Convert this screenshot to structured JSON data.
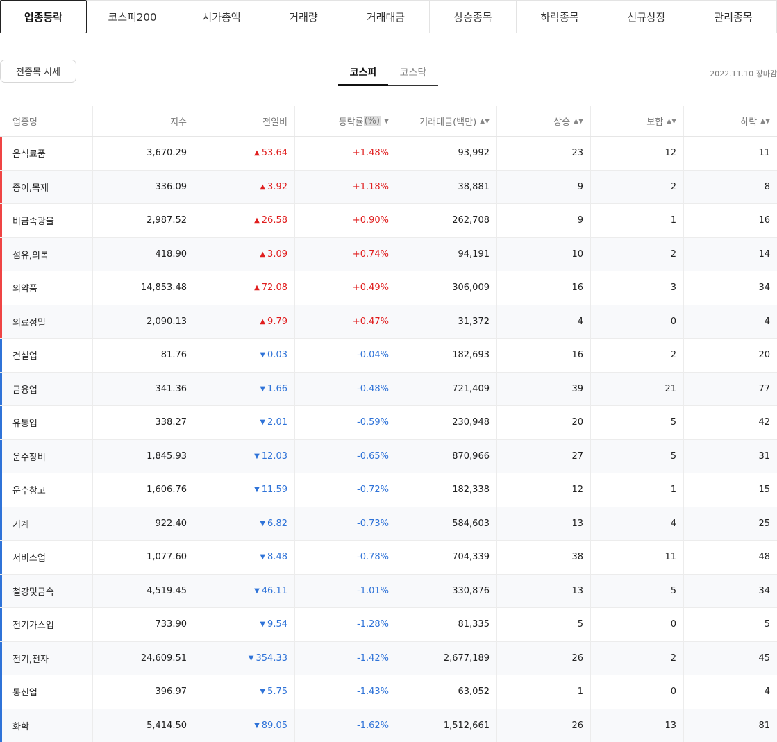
{
  "top_tabs": [
    "업종등락",
    "코스피200",
    "시가총액",
    "거래량",
    "거래대금",
    "상승종목",
    "하락종목",
    "신규상장",
    "관리종목"
  ],
  "all_button": "전종목 시세",
  "market_tabs": [
    "코스피",
    "코스닥"
  ],
  "date_text": "2022.11.10 장마감",
  "columns": {
    "name": "업종명",
    "index": "지수",
    "change": "전일비",
    "rate_pre": "등락률",
    "rate_pct": "(%)",
    "amount": "거래대금(백만)",
    "rise": "상승",
    "flat": "보합",
    "fall": "하락"
  },
  "icons": {
    "up": "▲",
    "down": "▼",
    "sort": "▲▼",
    "desc": "▼"
  },
  "colors": {
    "up": "#e01e1e",
    "down": "#2f73d8"
  },
  "rows": [
    {
      "name": "음식료품",
      "index": "3,670.29",
      "change": "53.64",
      "rate": "+1.48%",
      "amount": "93,992",
      "rise": "23",
      "flat": "12",
      "fall": "11",
      "dir": "up"
    },
    {
      "name": "종이,목재",
      "index": "336.09",
      "change": "3.92",
      "rate": "+1.18%",
      "amount": "38,881",
      "rise": "9",
      "flat": "2",
      "fall": "8",
      "dir": "up"
    },
    {
      "name": "비금속광물",
      "index": "2,987.52",
      "change": "26.58",
      "rate": "+0.90%",
      "amount": "262,708",
      "rise": "9",
      "flat": "1",
      "fall": "16",
      "dir": "up"
    },
    {
      "name": "섬유,의복",
      "index": "418.90",
      "change": "3.09",
      "rate": "+0.74%",
      "amount": "94,191",
      "rise": "10",
      "flat": "2",
      "fall": "14",
      "dir": "up"
    },
    {
      "name": "의약품",
      "index": "14,853.48",
      "change": "72.08",
      "rate": "+0.49%",
      "amount": "306,009",
      "rise": "16",
      "flat": "3",
      "fall": "34",
      "dir": "up"
    },
    {
      "name": "의료정밀",
      "index": "2,090.13",
      "change": "9.79",
      "rate": "+0.47%",
      "amount": "31,372",
      "rise": "4",
      "flat": "0",
      "fall": "4",
      "dir": "up"
    },
    {
      "name": "건설업",
      "index": "81.76",
      "change": "0.03",
      "rate": "-0.04%",
      "amount": "182,693",
      "rise": "16",
      "flat": "2",
      "fall": "20",
      "dir": "down"
    },
    {
      "name": "금융업",
      "index": "341.36",
      "change": "1.66",
      "rate": "-0.48%",
      "amount": "721,409",
      "rise": "39",
      "flat": "21",
      "fall": "77",
      "dir": "down"
    },
    {
      "name": "유통업",
      "index": "338.27",
      "change": "2.01",
      "rate": "-0.59%",
      "amount": "230,948",
      "rise": "20",
      "flat": "5",
      "fall": "42",
      "dir": "down"
    },
    {
      "name": "운수장비",
      "index": "1,845.93",
      "change": "12.03",
      "rate": "-0.65%",
      "amount": "870,966",
      "rise": "27",
      "flat": "5",
      "fall": "31",
      "dir": "down"
    },
    {
      "name": "운수창고",
      "index": "1,606.76",
      "change": "11.59",
      "rate": "-0.72%",
      "amount": "182,338",
      "rise": "12",
      "flat": "1",
      "fall": "15",
      "dir": "down"
    },
    {
      "name": "기계",
      "index": "922.40",
      "change": "6.82",
      "rate": "-0.73%",
      "amount": "584,603",
      "rise": "13",
      "flat": "4",
      "fall": "25",
      "dir": "down"
    },
    {
      "name": "서비스업",
      "index": "1,077.60",
      "change": "8.48",
      "rate": "-0.78%",
      "amount": "704,339",
      "rise": "38",
      "flat": "11",
      "fall": "48",
      "dir": "down"
    },
    {
      "name": "철강및금속",
      "index": "4,519.45",
      "change": "46.11",
      "rate": "-1.01%",
      "amount": "330,876",
      "rise": "13",
      "flat": "5",
      "fall": "34",
      "dir": "down"
    },
    {
      "name": "전기가스업",
      "index": "733.90",
      "change": "9.54",
      "rate": "-1.28%",
      "amount": "81,335",
      "rise": "5",
      "flat": "0",
      "fall": "5",
      "dir": "down"
    },
    {
      "name": "전기,전자",
      "index": "24,609.51",
      "change": "354.33",
      "rate": "-1.42%",
      "amount": "2,677,189",
      "rise": "26",
      "flat": "2",
      "fall": "45",
      "dir": "down"
    },
    {
      "name": "통신업",
      "index": "396.97",
      "change": "5.75",
      "rate": "-1.43%",
      "amount": "63,052",
      "rise": "1",
      "flat": "0",
      "fall": "4",
      "dir": "down"
    },
    {
      "name": "화학",
      "index": "5,414.50",
      "change": "89.05",
      "rate": "-1.62%",
      "amount": "1,512,661",
      "rise": "26",
      "flat": "13",
      "fall": "81",
      "dir": "down"
    }
  ]
}
